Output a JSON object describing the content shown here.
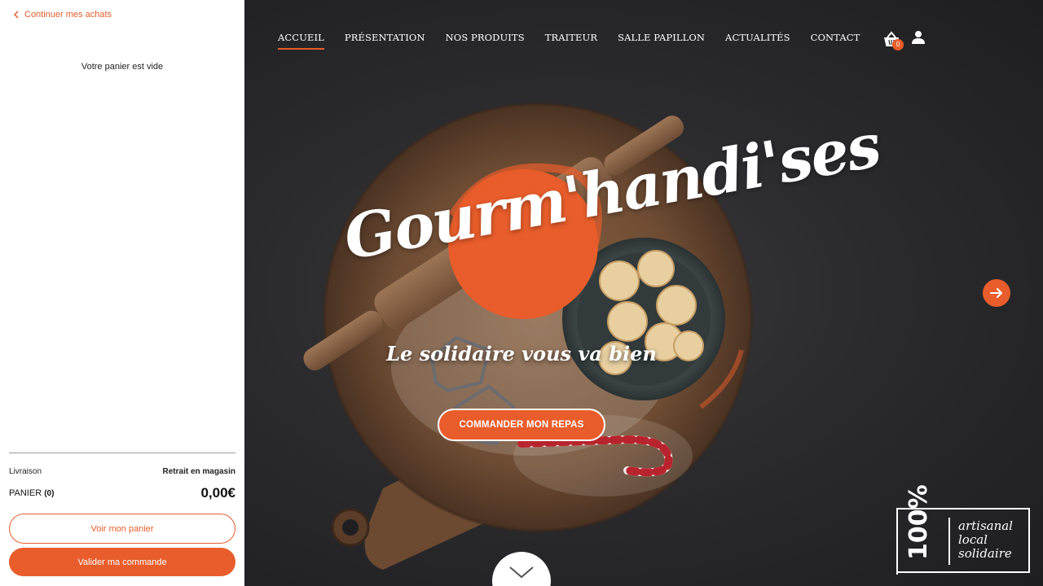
{
  "cart": {
    "continue_label": "Continuer mes achats",
    "empty_message": "Votre panier est vide",
    "delivery_label": "Livraison",
    "delivery_value": "Retrait en magasin",
    "cart_label": "PANIER",
    "cart_count": "(0)",
    "total": "0,00€",
    "view_cart_label": "Voir mon panier",
    "checkout_label": "Valider ma commande"
  },
  "nav": {
    "items": [
      {
        "label": "ACCUEIL",
        "active": true
      },
      {
        "label": "PRÉSENTATION"
      },
      {
        "label": "NOS PRODUITS"
      },
      {
        "label": "TRAITEUR"
      },
      {
        "label": "SALLE PAPILLON"
      },
      {
        "label": "ACTUALITÉS"
      },
      {
        "label": "CONTACT"
      }
    ],
    "basket_count": "0",
    "icons": [
      "basket-icon",
      "user-icon"
    ]
  },
  "hero": {
    "brand": "Gourm'handi'ses",
    "tagline": "Le solidaire vous va bien",
    "cta_label": "COMMANDER MON REPAS",
    "icons": [
      "arrow-right-icon",
      "chevron-down-icon"
    ]
  },
  "badge": {
    "percent": "100%",
    "words": [
      "artisanal",
      "local",
      "solidaire"
    ]
  },
  "colors": {
    "accent": "#e85d2b",
    "background": "#2a2a2c",
    "panel": "#ffffff"
  }
}
